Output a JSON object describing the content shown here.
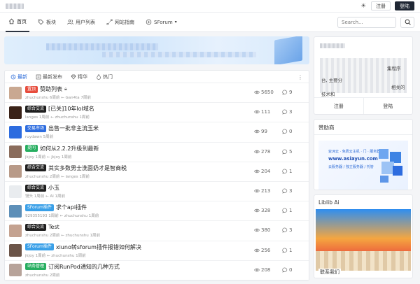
{
  "topbar": {
    "login_label": "注册",
    "register_label": "登陆"
  },
  "nav": {
    "items": [
      {
        "label": "首页",
        "icon": "home-icon",
        "active": true
      },
      {
        "label": "板块",
        "icon": "tag-icon"
      },
      {
        "label": "用户列表",
        "icon": "users-icon"
      },
      {
        "label": "网站指南",
        "icon": "route-icon"
      },
      {
        "label": "SForum",
        "icon": "sforum-icon"
      }
    ],
    "search_placeholder": "Search..."
  },
  "tabs": [
    {
      "label": "最新",
      "icon": "clock-icon",
      "active": true
    },
    {
      "label": "最新发布",
      "icon": "list-icon"
    },
    {
      "label": "精华",
      "icon": "gem-icon"
    },
    {
      "label": "热门",
      "icon": "fire-icon"
    }
  ],
  "topics": [
    {
      "badge": "置顶",
      "badge_color": "#e74c3c",
      "title": "赞助列表",
      "lock": true,
      "meta": "zhuchunshu 6周前 ← Gan4ta 7周前",
      "views": "5650",
      "replies": "9",
      "avatar_color": "#c9a891"
    },
    {
      "badge": "综合交流",
      "badge_color": "#1f1f1f",
      "title": "[已关]10年lol域名",
      "meta": "langes 1周前 ← zhuchunshu 1周前",
      "views": "111",
      "replies": "3",
      "avatar_color": "#3a2218"
    },
    {
      "badge": "交易市场",
      "badge_color": "#2d6cdf",
      "title": "出售一批非主流玉米",
      "meta": "ruydawn 5周前",
      "views": "99",
      "replies": "0",
      "avatar_color": "#2d6cdf"
    },
    {
      "badge": "提问",
      "badge_color": "#27ae60",
      "title": "如何从2.2.2升级到最新",
      "meta": "jkjoy 1周前 ← jkjoy 1周前",
      "views": "278",
      "replies": "5",
      "avatar_color": "#8a6c5c"
    },
    {
      "badge": "综合交流",
      "badge_color": "#1f1f1f",
      "title": "其实多数男士洗面奶才是智商税",
      "meta": "zhuchunshu 2周前 ← langes 1周前",
      "views": "204",
      "replies": "1",
      "avatar_color": "#b89a88"
    },
    {
      "badge": "综合交流",
      "badge_color": "#1f1f1f",
      "title": "小玉",
      "meta": "馒头 1周前 ← AI 1周前",
      "views": "213",
      "replies": "3",
      "avatar_color": "#e9ecef"
    },
    {
      "badge": "SForum插件",
      "badge_color": "#3aa0e8",
      "title": "求个api插件",
      "meta": "929355193 1周前 ← zhuchunshu 1周前",
      "views": "328",
      "replies": "1",
      "avatar_color": "#5d8fb8"
    },
    {
      "badge": "综合交流",
      "badge_color": "#1f1f1f",
      "title": "Test",
      "meta": "zhuchunshu 2周前 ← zhuchunshu 1周前",
      "views": "380",
      "replies": "3",
      "avatar_color": "#c4a290"
    },
    {
      "badge": "SForum插件",
      "badge_color": "#3aa0e8",
      "title": "xiuno转sforum插件报错如何解决",
      "meta": "jkjoy 1周前 ← zhuchunshu 1周前",
      "views": "256",
      "replies": "1",
      "avatar_color": "#6b5448"
    },
    {
      "badge": "站务管理",
      "badge_color": "#27ae60",
      "title": "订阅RunPod通知的几种方式",
      "meta": "zhuchunshu 2周前",
      "views": "208",
      "replies": "0",
      "avatar_color": "#b7a39a"
    }
  ],
  "sidebar": {
    "welcome_text_1": "集程序",
    "welcome_text_2": "台, 主要分",
    "welcome_text_3": "相关的",
    "welcome_text_4": "技术和",
    "login_label": "注册",
    "register_label": "登陆",
    "sponsor_title": "赞助商",
    "ad_line_1": "亚洲云 · 免费云主机 · 门 · 服务器",
    "ad_line_2": "www.asiayun.com",
    "ad_line_3": "云服务器 / 独立服务器 / 托管",
    "liblib_title": "Liblib Ai",
    "contact_label": "联系我们"
  }
}
